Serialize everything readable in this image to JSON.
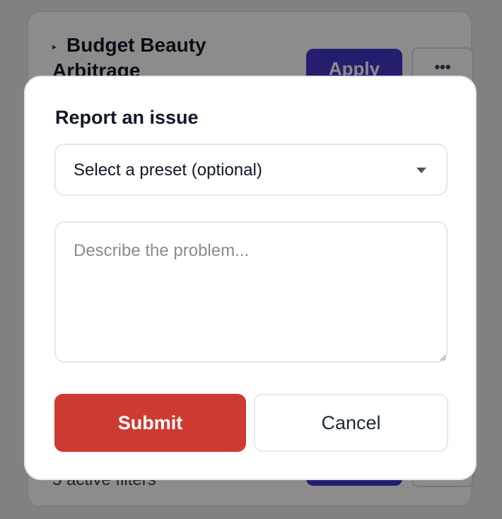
{
  "background": {
    "card": {
      "caret": "▸",
      "title": "Budget Beauty Arbitrage",
      "apply_label": "Apply",
      "more_label": "•••",
      "filters_text": "5 active filters"
    }
  },
  "modal": {
    "title": "Report an issue",
    "preset": {
      "selected": "Select a preset (optional)"
    },
    "description": {
      "value": "",
      "placeholder": "Describe the problem..."
    },
    "submit_label": "Submit",
    "cancel_label": "Cancel"
  },
  "colors": {
    "submit": "#cd3a31",
    "apply": "#4338ca",
    "overlay": "rgba(0,0,0,0.45)"
  }
}
